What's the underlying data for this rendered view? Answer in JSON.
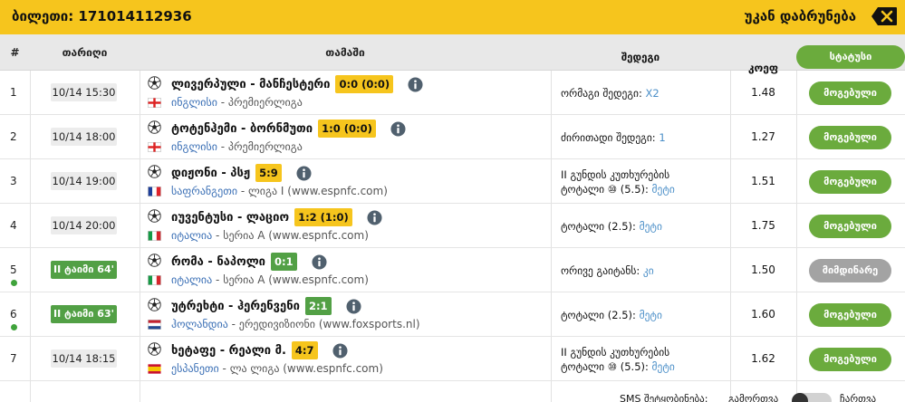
{
  "header": {
    "ticket_label": "ბილეთი: 171014112936",
    "back_label": "უკან დაბრუნება",
    "back_icon": "backspace-close-icon",
    "bg_color": "#f6c51d"
  },
  "columns": {
    "num": "#",
    "date": "თარიღი",
    "game": "თამაში",
    "result": "შედეგი",
    "coef": "კოეფ",
    "status": "სტატუსი"
  },
  "rows": [
    {
      "num": "1",
      "time": "10/14 15:30",
      "live": false,
      "match": "ლივერპული - მანჩესტერი",
      "score": "0:0 (0:0)",
      "country": "ინგლისი",
      "league": " - პრემიერლიგა",
      "flag": "england",
      "result_line1": "",
      "result_text": "ორმაგი შედეგი: ",
      "result_pick": "X2",
      "coef": "1.48",
      "status": "მოგებული",
      "status_type": "won"
    },
    {
      "num": "2",
      "time": "10/14 18:00",
      "live": false,
      "match": "ტოტენჰემი - ბორნმუთი",
      "score": "1:0 (0:0)",
      "country": "ინგლისი",
      "league": " - პრემიერლიგა",
      "flag": "england",
      "result_line1": "",
      "result_text": "ძირითადი შედეგი: ",
      "result_pick": "1",
      "coef": "1.27",
      "status": "მოგებული",
      "status_type": "won"
    },
    {
      "num": "3",
      "time": "10/14 19:00",
      "live": false,
      "match": "დიჟონი - პსჟ",
      "score": "5:9",
      "country": "საფრანგეთი",
      "league": " - ლიგა I (www.espnfc.com)",
      "flag": "france",
      "result_line1": "II გუნდის კუთხურების",
      "result_text": "ტოტალი ⑩ (5.5): ",
      "result_pick": "მეტი",
      "coef": "1.51",
      "status": "მოგებული",
      "status_type": "won"
    },
    {
      "num": "4",
      "time": "10/14 20:00",
      "live": false,
      "match": "იუვენტუსი - ლაციო",
      "score": "1:2 (1:0)",
      "country": "იტალია",
      "league": " - სერია A (www.espnfc.com)",
      "flag": "italy",
      "result_line1": "",
      "result_text": "ტოტალი (2.5): ",
      "result_pick": "მეტი",
      "coef": "1.75",
      "status": "მოგებული",
      "status_type": "won"
    },
    {
      "num": "5",
      "time": "II ტაიმი 64'",
      "live": true,
      "match": "რომა - ნაპოლი",
      "score": "0:1",
      "country": "იტალია",
      "league": " - სერია A (www.espnfc.com)",
      "flag": "italy",
      "result_line1": "",
      "result_text": "ორივე გაიტანს: ",
      "result_pick": "კი",
      "coef": "1.50",
      "status": "მიმდინარე",
      "status_type": "pending"
    },
    {
      "num": "6",
      "time": "II ტაიმი 63'",
      "live": true,
      "match": "უტრეხტი - ჰერენვენი",
      "score": "2:1",
      "country": "ჰოლანდია",
      "league": " - ერედივიზიონი (www.foxsports.nl)",
      "flag": "netherlands",
      "result_line1": "",
      "result_text": "ტოტალი (2.5): ",
      "result_pick": "მეტი",
      "coef": "1.60",
      "status": "მოგებული",
      "status_type": "won"
    },
    {
      "num": "7",
      "time": "10/14 18:15",
      "live": false,
      "match": "ხეტაფე - რეალი მ.",
      "score": "4:7",
      "country": "ესპანეთი",
      "league": " - ლა ლიგა (www.espnfc.com)",
      "flag": "spain",
      "result_line1": "II გუნდის კუთხურების",
      "result_text": "ტოტალი ⑩ (5.5): ",
      "result_pick": "მეტი",
      "coef": "1.62",
      "status": "მოგებული",
      "status_type": "won"
    }
  ],
  "footer": {
    "sms_label": "SMS შეტყობინება:",
    "off_label": "გამორთვა",
    "on_label": "ჩართვა"
  },
  "colors": {
    "won": "#6bab3d",
    "pending": "#a3a3a3",
    "score": "#f6c51d",
    "live": "#52a045"
  }
}
